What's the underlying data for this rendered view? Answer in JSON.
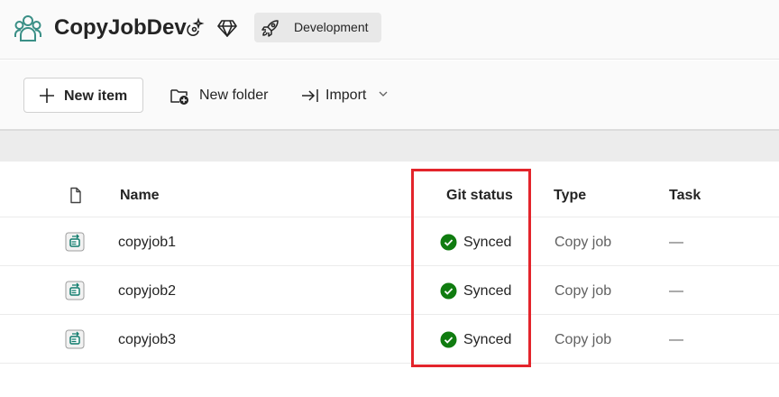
{
  "workspace": {
    "name": "CopyJobDev",
    "badge_label": "Development"
  },
  "toolbar": {
    "new_item_label": "New item",
    "new_folder_label": "New folder",
    "import_label": "Import"
  },
  "table": {
    "headers": {
      "name": "Name",
      "git_status": "Git status",
      "type": "Type",
      "task": "Task"
    },
    "rows": [
      {
        "name": "copyjob1",
        "git_status": "Synced",
        "type": "Copy job",
        "task": "—"
      },
      {
        "name": "copyjob2",
        "git_status": "Synced",
        "type": "Copy job",
        "task": "—"
      },
      {
        "name": "copyjob3",
        "git_status": "Synced",
        "type": "Copy job",
        "task": "—"
      }
    ]
  },
  "colors": {
    "synced": "#107c10",
    "highlight": "#e3242b",
    "workspace_icon": "#0f7b6c"
  }
}
